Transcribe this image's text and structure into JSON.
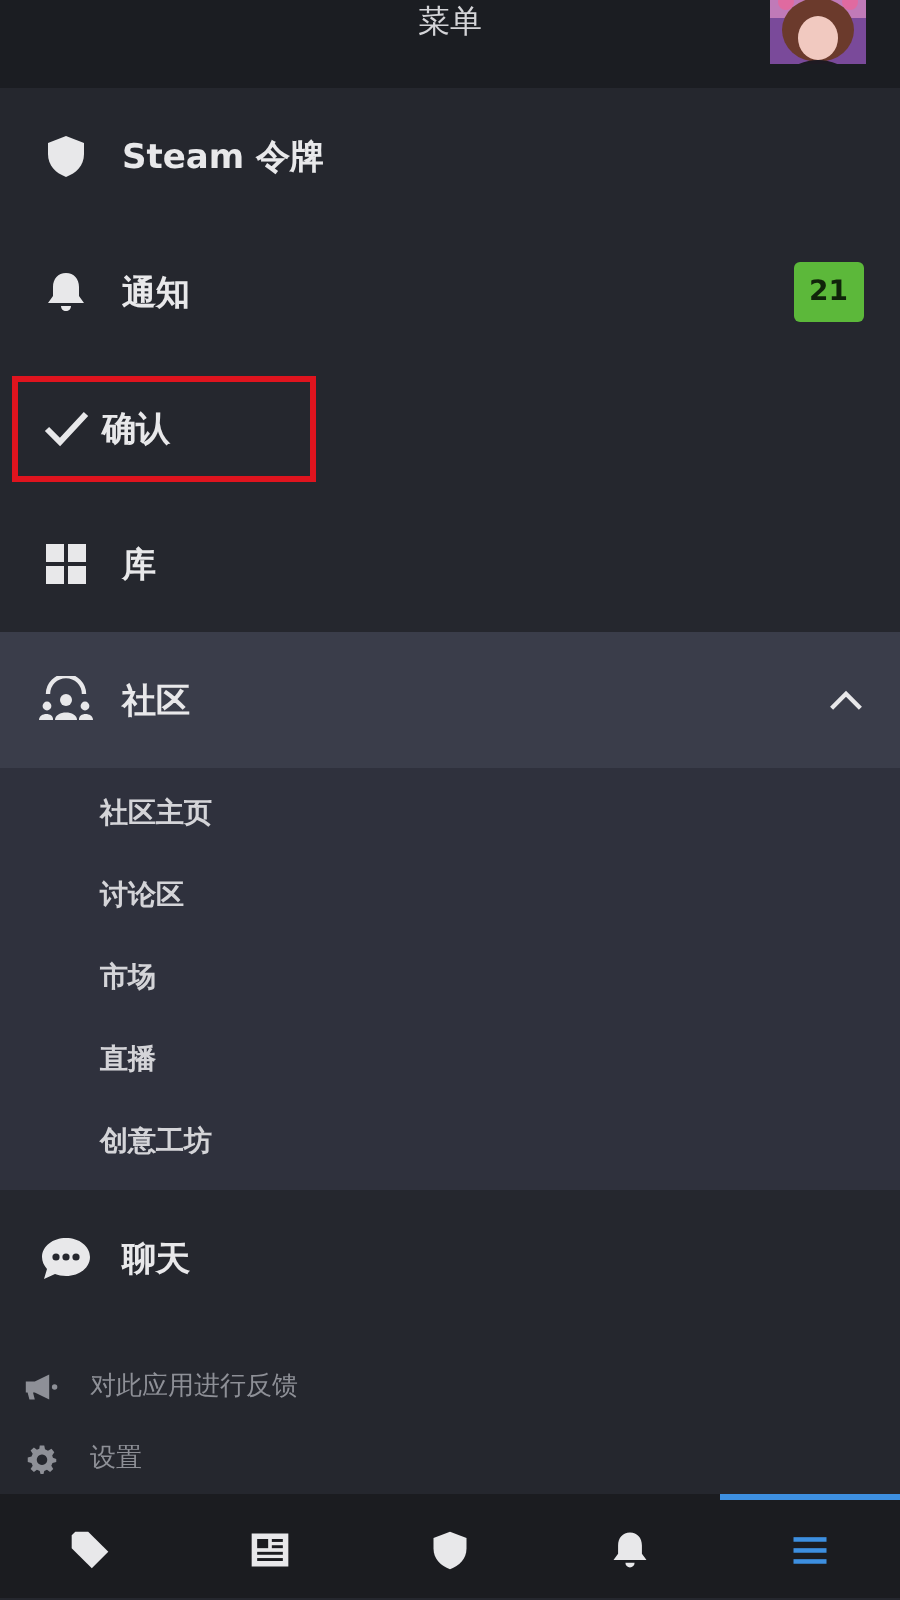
{
  "header": {
    "title": "菜单"
  },
  "menu": [
    {
      "kind": "shield",
      "label": "Steam 令牌",
      "highlighted": false
    },
    {
      "kind": "bell",
      "label": "通知",
      "badge": "21",
      "highlighted": false
    },
    {
      "kind": "check",
      "label": "确认",
      "highlighted": true
    },
    {
      "kind": "grid",
      "label": "库",
      "highlighted": false
    }
  ],
  "community": {
    "kind": "people",
    "label": "社区",
    "expanded": true,
    "children": [
      {
        "label": "社区主页"
      },
      {
        "label": "讨论区"
      },
      {
        "label": "市场"
      },
      {
        "label": "直播"
      },
      {
        "label": "创意工坊"
      }
    ]
  },
  "chat": {
    "kind": "chat",
    "label": "聊天"
  },
  "footer": [
    {
      "kind": "megaphone",
      "label": "对此应用进行反馈"
    },
    {
      "kind": "gear",
      "label": "设置"
    }
  ],
  "bottom_nav": [
    {
      "kind": "tag",
      "selected": false
    },
    {
      "kind": "news",
      "selected": false
    },
    {
      "kind": "shield",
      "selected": false
    },
    {
      "kind": "bell",
      "selected": false
    },
    {
      "kind": "menu",
      "selected": true
    }
  ]
}
